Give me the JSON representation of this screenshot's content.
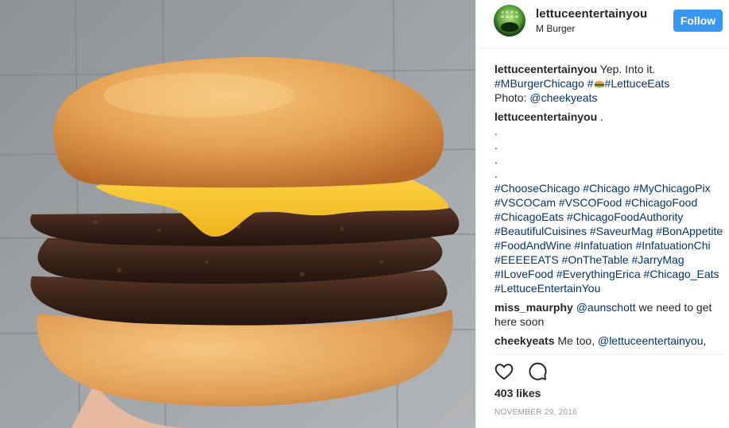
{
  "post": {
    "image": {
      "name": "burger-photo"
    },
    "header": {
      "username": "lettuceentertainyou",
      "location": "M Burger",
      "follow_label": "Follow"
    },
    "caption": {
      "author": "lettuceentertainyou",
      "line1": "Yep. Into it.",
      "tag1": "#MBurgerChicago",
      "tag2_prefix": "#",
      "tag2": "#LettuceEats",
      "photo_label": "Photo:",
      "photo_mention": "@cheekyeats"
    },
    "hashtag_comment": {
      "author": "lettuceentertainyou",
      "text": ".",
      "dots": [
        ".",
        ".",
        ".",
        "."
      ],
      "hashtags": "#ChooseChicago #Chicago #MyChicagoPix #VSCOCam #VSCOFood #ChicagoFood #ChicagoEats #ChicagoFoodAuthority #BeautifulCuisines #SaveurMag #BonAppetite #FoodAndWine #Infatuation #InfatuationChi #EEEEEATS #OnTheTable #JarryMag #ILoveFood #EverythingErica #Chicago_Eats #LettuceEntertainYou"
    },
    "comments": [
      {
        "author": "miss_maurphy",
        "mention": "@aunschott",
        "text": " we need to get here soon"
      },
      {
        "author": "cheekyeats",
        "text": " Me too, ",
        "mention": "@lettuceentertainyou",
        "tail": ","
      }
    ],
    "actions": {
      "like_icon": "heart-outline-icon",
      "comment_icon": "speech-bubble-icon"
    },
    "likes": "403 likes",
    "date": "NOVEMBER 29, 2016"
  }
}
